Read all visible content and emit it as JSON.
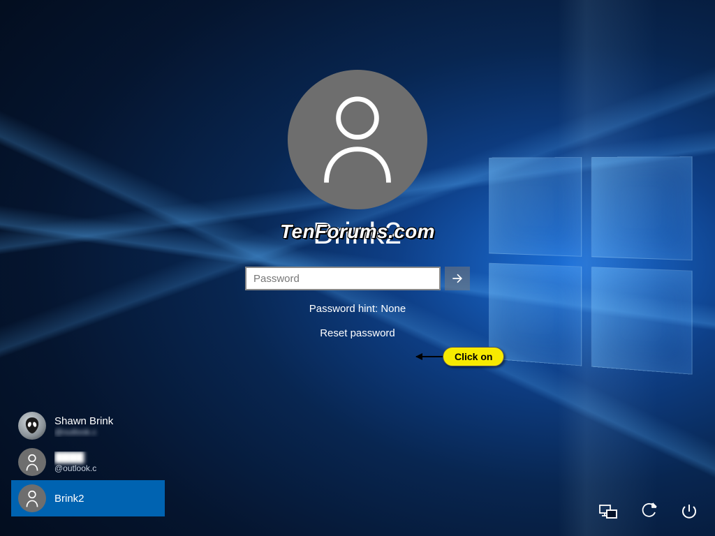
{
  "watermark": "TenForums.com",
  "login": {
    "username": "Brink2",
    "password_placeholder": "Password",
    "password_value": "",
    "hint_text": "Password hint: None",
    "reset_text": "Reset password"
  },
  "callout": {
    "label": "Click on"
  },
  "users": [
    {
      "name": "Shawn Brink",
      "sub": "@outlook.c",
      "avatar": "alien",
      "selected": false,
      "blurred_sub": true
    },
    {
      "name": "",
      "sub": "@outlook.c",
      "avatar": "generic",
      "selected": false,
      "blurred_name": true
    },
    {
      "name": "Brink2",
      "sub": "",
      "avatar": "generic",
      "selected": true
    }
  ],
  "icons": {
    "network": "network-icon",
    "ease": "ease-of-access-icon",
    "power": "power-icon",
    "submit": "submit-arrow-icon",
    "person": "person-icon"
  }
}
